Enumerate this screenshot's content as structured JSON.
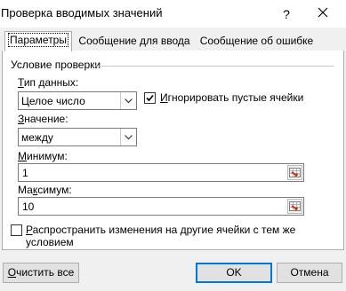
{
  "window": {
    "title": "Проверка вводимых значений",
    "help_glyph": "?",
    "close_icon": "close-icon"
  },
  "tabs": [
    {
      "label": "Параметры",
      "active": true
    },
    {
      "label": "Сообщение для ввода",
      "active": false
    },
    {
      "label": "Сообщение об ошибке",
      "active": false
    }
  ],
  "group": {
    "title": "Условие проверки"
  },
  "data_type": {
    "label_underlined": "Т",
    "label_rest": "ип данных:",
    "value": "Целое число"
  },
  "ignore_blank": {
    "label_underlined": "И",
    "label_rest": "гнорировать пустые ячейки",
    "checked": true
  },
  "operator": {
    "label_underlined": "З",
    "label_rest": "начение:",
    "value": "между"
  },
  "minimum": {
    "label_underlined": "М",
    "label_rest": "инимум:",
    "value": "1"
  },
  "maximum": {
    "label_rest_before": "Ма",
    "label_underlined": "к",
    "label_rest": "симум:",
    "value": "10"
  },
  "apply_all": {
    "label_underlined": "Р",
    "label_line1_rest": "аспространить изменения на другие ячейки с тем же",
    "label_line2": "условием",
    "checked": false
  },
  "buttons": {
    "clear_underlined": "О",
    "clear_rest": "чистить все",
    "ok": "OK",
    "cancel": "Отмена"
  }
}
